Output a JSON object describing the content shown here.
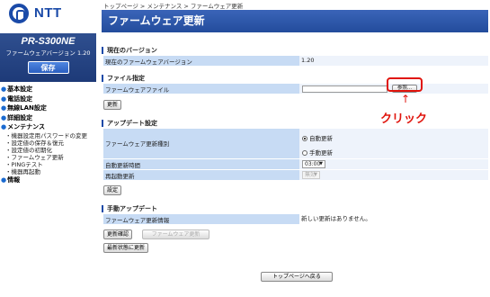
{
  "logo": {
    "text": "NTT"
  },
  "product": {
    "name": "PR-S300NE",
    "firmware_version_label": "ファームウェアバージョン 1.20",
    "save_label": "保存"
  },
  "menu": {
    "basic": "基本設定",
    "phone": "電話設定",
    "wlan": "無線LAN設定",
    "detail": "詳細設定",
    "maintenance": "メンテナンス",
    "maint_items": [
      "・機器設定用パスワードの変更",
      "・設定値の保存＆復元",
      "・設定値の初期化",
      "・ファームウェア更新",
      "・PINGテスト",
      "・機器再起動"
    ],
    "info": "情報"
  },
  "breadcrumb": "トップページ > メンテナンス > ファームウェア更新",
  "page_title": "ファームウェア更新",
  "current_version": {
    "heading": "現在のバージョン",
    "label": "現在のファームウェアバージョン",
    "value": "1.20"
  },
  "file_spec": {
    "heading": "ファイル指定",
    "label": "ファームウェアファイル",
    "browse_label": "参照...",
    "update_label": "更新"
  },
  "annotation": {
    "arrow": "↑",
    "text": "クリック"
  },
  "update_settings": {
    "heading": "アップデート設定",
    "type_label": "ファームウェア更新種別",
    "auto_label": "自動更新",
    "manual_label": "手動更新",
    "auto_time_label": "自動更新時間",
    "auto_time_value": "03:00",
    "restart_label": "再起動更新",
    "restart_value": "無効",
    "set_label": "設定"
  },
  "manual_update": {
    "heading": "手動アップデート",
    "info_label": "ファームウェア更新情報",
    "info_value": "新しい更新はありません。",
    "check_label": "更新確認",
    "fw_update_label": "ファームウェア更新",
    "latest_label": "最新状態に更新"
  },
  "back_to_top": "トップページへ戻る",
  "colors": {
    "accent": "#1a4aa8",
    "row_bg": "#c7dbf4",
    "annotation": "#e0140c"
  }
}
